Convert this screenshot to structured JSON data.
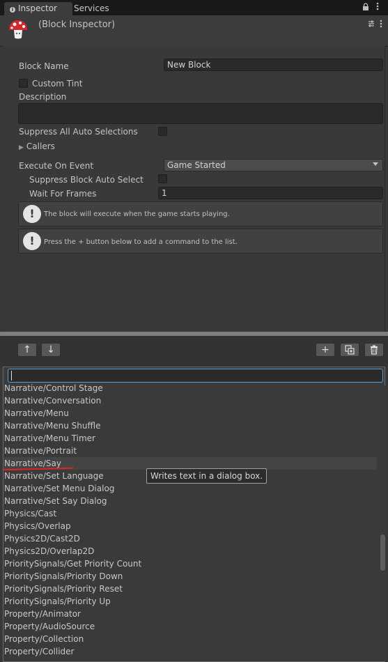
{
  "tabs": {
    "inspector": "Inspector",
    "services": "Services"
  },
  "icons": {
    "lock": "lock-icon",
    "menu": "menu-dots-icon",
    "pin": "pin-icon"
  },
  "header": {
    "title": "(Block Inspector)"
  },
  "form": {
    "block_name_label": "Block Name",
    "block_name_value": "New Block",
    "custom_tint_label": "Custom Tint",
    "description_label": "Description",
    "description_value": "",
    "suppress_all_label": "Suppress All Auto Selections",
    "callers_label": "Callers",
    "execute_label": "Execute On Event",
    "execute_value": "Game Started",
    "suppress_block_label": "Suppress Block Auto Select",
    "wait_frames_label": "Wait For Frames",
    "wait_frames_value": "1",
    "help1": "The block will execute when the game starts playing.",
    "help2": "Press the + button below to add a command to the list."
  },
  "toolbar": {
    "up": "↑",
    "down": "↓",
    "add": "+",
    "duplicate": "⧉",
    "delete": "🗑"
  },
  "list": {
    "search_value": "",
    "items": [
      "Narrative/Control Stage",
      "Narrative/Conversation",
      "Narrative/Menu",
      "Narrative/Menu Shuffle",
      "Narrative/Menu Timer",
      "Narrative/Portrait",
      "Narrative/Say",
      "Narrative/Set Language",
      "Narrative/Set Menu Dialog",
      "Narrative/Set Say Dialog",
      "Physics/Cast",
      "Physics/Overlap",
      "Physics2D/Cast2D",
      "Physics2D/Overlap2D",
      "PrioritySignals/Get Priority Count",
      "PrioritySignals/Priority Down",
      "PrioritySignals/Priority Reset",
      "PrioritySignals/Priority Up",
      "Property/Animator",
      "Property/AudioSource",
      "Property/Collection",
      "Property/Collider"
    ],
    "selected_index": 6,
    "tooltip": "Writes text in a dialog box."
  },
  "colors": {
    "accent_red": "#e02424",
    "search_focus": "#5a9fd6"
  }
}
